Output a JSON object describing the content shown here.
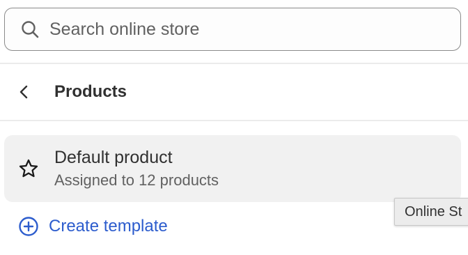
{
  "search": {
    "placeholder": "Search online store",
    "icon": "search-icon"
  },
  "header": {
    "title": "Products",
    "back_icon": "chevron-left-icon"
  },
  "templates": [
    {
      "name": "Default product",
      "subtitle": "Assigned to 12 products",
      "icon": "star-icon"
    }
  ],
  "create_template": {
    "label": "Create template",
    "icon": "plus-circle-icon"
  },
  "tooltip": {
    "text": "Online St"
  },
  "colors": {
    "link": "#2c5ccd",
    "item_background": "#f1f1f1",
    "text": "#303030",
    "muted_text": "#616161"
  }
}
